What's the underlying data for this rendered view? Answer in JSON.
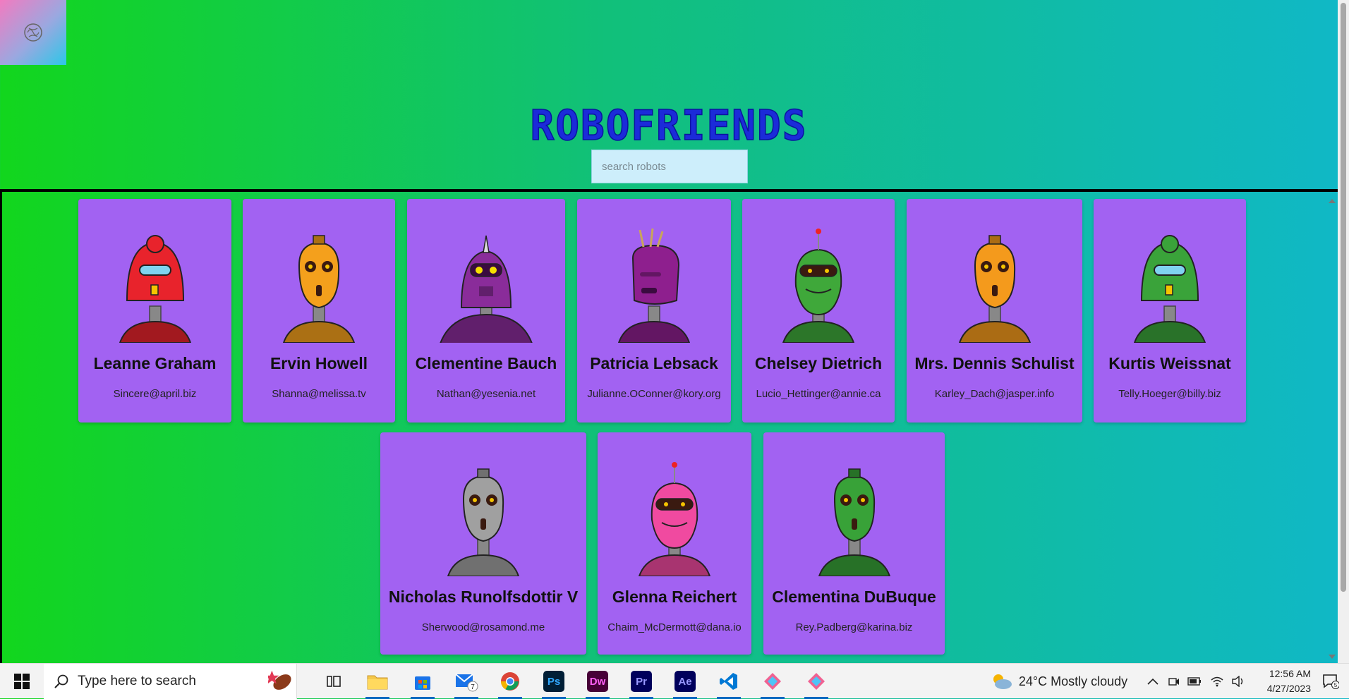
{
  "app": {
    "title": "ROBOFRIENDS",
    "search_placeholder": "search robots"
  },
  "robots": [
    {
      "name": "Leanne Graham",
      "email": "Sincere@april.biz",
      "color": "#e8232c",
      "head": "dome"
    },
    {
      "name": "Ervin Howell",
      "email": "Shanna@melissa.tv",
      "color": "#f4a01c",
      "head": "egg"
    },
    {
      "name": "Clementine Bauch",
      "email": "Nathan@yesenia.net",
      "color": "#8a2c9a",
      "head": "wide"
    },
    {
      "name": "Patricia Lebsack",
      "email": "Julianne.OConner@kory.org",
      "color": "#8e1f8e",
      "head": "box"
    },
    {
      "name": "Chelsey Dietrich",
      "email": "Lucio_Hettinger@annie.ca",
      "color": "#3fa83a",
      "head": "visor"
    },
    {
      "name": "Mrs. Dennis Schulist",
      "email": "Karley_Dach@jasper.info",
      "color": "#f49a1c",
      "head": "egg"
    },
    {
      "name": "Kurtis Weissnat",
      "email": "Telly.Hoeger@billy.biz",
      "color": "#3aa33a",
      "head": "dome"
    },
    {
      "name": "Nicholas Runolfsdottir V",
      "email": "Sherwood@rosamond.me",
      "color": "#a0a0a0",
      "head": "egg"
    },
    {
      "name": "Glenna Reichert",
      "email": "Chaim_McDermott@dana.io",
      "color": "#f04aa0",
      "head": "visor"
    },
    {
      "name": "Clementina DuBuque",
      "email": "Rey.Padberg@karina.biz",
      "color": "#38a238",
      "head": "egg"
    }
  ],
  "taskbar": {
    "search_text": "Type here to search",
    "mail_badge": "7",
    "apps": [
      {
        "name": "task-view",
        "label": ""
      },
      {
        "name": "file-explorer",
        "label": ""
      },
      {
        "name": "microsoft-store",
        "label": ""
      },
      {
        "name": "mail",
        "label": ""
      },
      {
        "name": "chrome",
        "label": ""
      },
      {
        "name": "photoshop",
        "label": "Ps",
        "color": "#001e36",
        "fg": "#31a8ff"
      },
      {
        "name": "dreamweaver",
        "label": "Dw",
        "color": "#470137",
        "fg": "#ff61f6"
      },
      {
        "name": "premiere",
        "label": "Pr",
        "color": "#00005b",
        "fg": "#9999ff"
      },
      {
        "name": "after-effects",
        "label": "Ae",
        "color": "#00005b",
        "fg": "#9999ff"
      },
      {
        "name": "vscode",
        "label": ""
      },
      {
        "name": "app-pinned-1",
        "label": ""
      },
      {
        "name": "app-pinned-2",
        "label": ""
      }
    ],
    "weather": "24°C  Mostly cloudy",
    "time": "12:56 AM",
    "date": "4/27/2023",
    "notification_count": "5"
  }
}
